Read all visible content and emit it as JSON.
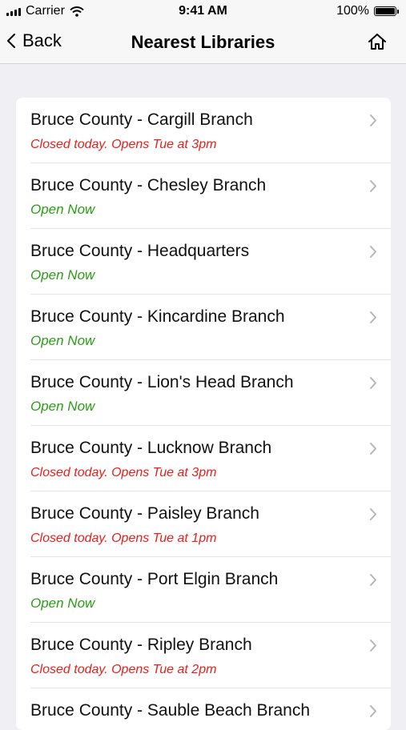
{
  "status_bar": {
    "carrier": "Carrier",
    "time": "9:41 AM",
    "battery": "100%",
    "battery_level": 1.0
  },
  "nav": {
    "back_label": "Back",
    "title": "Nearest Libraries",
    "back_icon": "chevron-left-icon",
    "home_icon": "home-icon"
  },
  "colors": {
    "open": "#2a9d15",
    "closed": "#e8201c",
    "background": "#efeff4"
  },
  "libraries": [
    {
      "name": "Bruce County - Cargill Branch",
      "status": "Closed today. Opens Tue at 3pm",
      "state": "closed"
    },
    {
      "name": "Bruce County - Chesley Branch",
      "status": "Open Now",
      "state": "open"
    },
    {
      "name": "Bruce County - Headquarters",
      "status": "Open Now",
      "state": "open"
    },
    {
      "name": "Bruce County - Kincardine Branch",
      "status": "Open Now",
      "state": "open"
    },
    {
      "name": "Bruce County - Lion's Head Branch",
      "status": "Open Now",
      "state": "open"
    },
    {
      "name": "Bruce County - Lucknow Branch",
      "status": "Closed today. Opens Tue at 3pm",
      "state": "closed"
    },
    {
      "name": "Bruce County - Paisley Branch",
      "status": "Closed today. Opens Tue at 1pm",
      "state": "closed"
    },
    {
      "name": "Bruce County - Port Elgin Branch",
      "status": "Open Now",
      "state": "open"
    },
    {
      "name": "Bruce County - Ripley Branch",
      "status": "Closed today. Opens Tue at 2pm",
      "state": "closed"
    },
    {
      "name": "Bruce County - Sauble Beach Branch",
      "status": "",
      "state": "unknown"
    }
  ]
}
